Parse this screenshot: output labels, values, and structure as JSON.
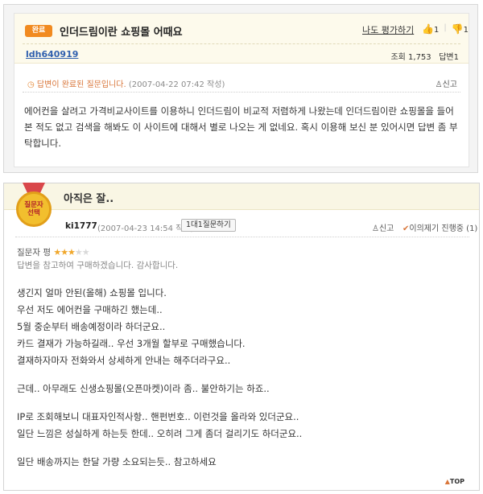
{
  "question": {
    "status_badge": "완료",
    "title": "인더드림이란 쇼핑몰 어때요",
    "rate_link": "나도 평가하기",
    "thumbs_up_count": "1",
    "thumbs_down_count": "1",
    "author": "ldh640919",
    "views_label": "조회",
    "views": "1,753",
    "answers_label": "답변",
    "answers": "1",
    "status_text": "답변이 완료된 질문입니다.",
    "timestamp": "(2007-04-22 07:42 작성)",
    "report_label": "신고",
    "body": "에어컨을 살려고 가격비교사이트를 이용하니 인더드림이 비교적 저렴하게 나왔는데 인더드림이란  쇼핑몰을 들어본 적도 없고 검색을 해봐도 이 사이트에 대해서 별로 나오는 게  없네요. 혹시 이용해 보신 분 있어시면 답변 좀 부탁합니다."
  },
  "answer": {
    "medal_line1": "질문자",
    "medal_line2": "선택",
    "title": "아직은 잘..",
    "author": "ki1777",
    "timestamp": "(2007-04-23 14:54 작성)",
    "ask_button": "1대1질문하기",
    "report_label": "신고",
    "objection_label": "이의제기 진행중",
    "objection_count": "(1)",
    "rating_label": "질문자 평",
    "rating": 3,
    "rating_max": 5,
    "rating_comment": "답변을 참고하여 구매하겠습니다. 감사합니다.",
    "lines": [
      "생긴지 얼마 안된(올해) 쇼핑몰 입니다.",
      "우선 저도 에어컨을 구매하긴 했는데..",
      "5월 중순부터 배송예정이라 하더군요..",
      "카드 결재가 가능하길래.. 우선 3개월 할부로 구매했습니다.",
      "결재하자마자 전화와서 상세하게 안내는 해주더라구요..",
      "",
      "근데.. 아무래도 신생쇼핑몰(오픈마켓)이라 좀.. 불안하기는 하죠..",
      "",
      "IP로 조회해보니 대표자인적사항.. 핸펀번호.. 이런것을 올라와 있더군요..",
      "일단 느낌은 성실하게 하는듯 한데.. 오히려 그게 좀더 걸리기도 하더군요..",
      "",
      "일단 배송까지는 한달 가량 소요되는듯.. 참고하세요"
    ],
    "top_label": "TOP"
  },
  "colors": {
    "accent_orange": "#f18a20",
    "link_blue": "#2f5fae",
    "header_bg": "#fdfaec"
  }
}
